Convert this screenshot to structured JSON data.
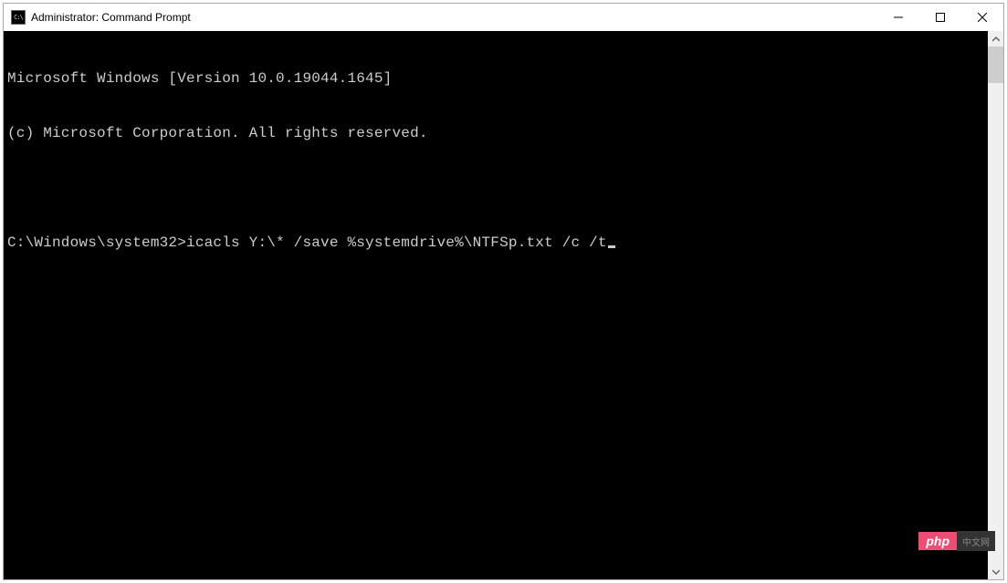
{
  "window": {
    "title": "Administrator: Command Prompt",
    "icon_label": "cmd-icon"
  },
  "terminal": {
    "header_line1": "Microsoft Windows [Version 10.0.19044.1645]",
    "header_line2": "(c) Microsoft Corporation. All rights reserved.",
    "prompt": "C:\\Windows\\system32>",
    "command": "icacls Y:\\* /save %systemdrive%\\NTFSp.txt /c /t"
  },
  "watermark": {
    "left": "php",
    "right": "中文网"
  }
}
